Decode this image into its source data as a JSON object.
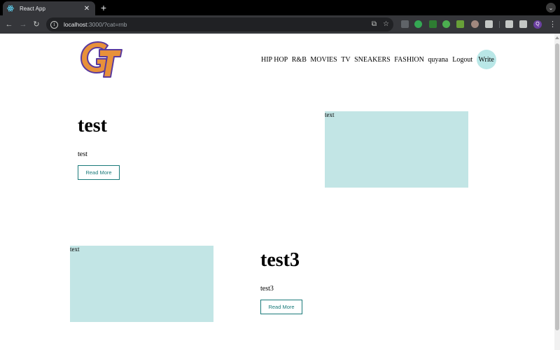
{
  "browser": {
    "tab": {
      "title": "React App",
      "close": "✕"
    },
    "newtab": "+",
    "tabmenu": "⌄",
    "address": {
      "host": "localhost",
      "path": ":3000/?cat=rnb"
    },
    "profile_initial": "Q"
  },
  "nav": {
    "links": [
      "HIP HOP",
      "R&B",
      "MOVIES",
      "TV",
      "SNEAKERS",
      "FASHION"
    ],
    "username": "quyana",
    "logout": "Logout",
    "write": "Write"
  },
  "posts": [
    {
      "title": "test",
      "desc": "test",
      "read_more": "Read More",
      "image_alt": "text"
    },
    {
      "title": "test3",
      "desc": "test3",
      "read_more": "Read More",
      "image_alt": "text"
    }
  ],
  "colors": {
    "accent": "#1a7a7a",
    "image_placeholder": "#c2e5e5",
    "write_bg": "#b9e7e7",
    "logo_fill": "#e8913a",
    "logo_outline": "#5a3a9e"
  }
}
